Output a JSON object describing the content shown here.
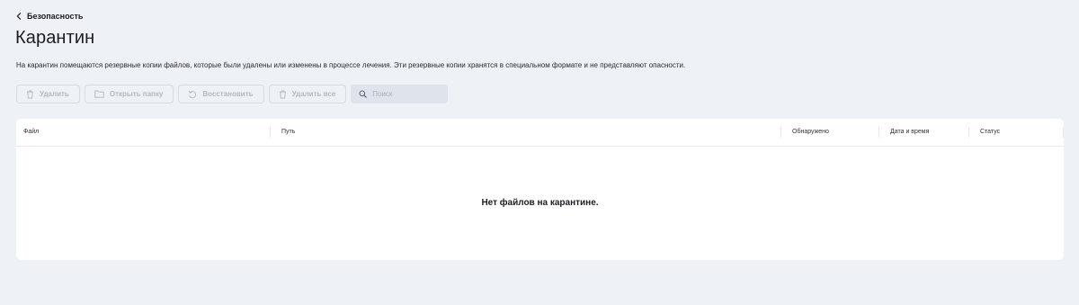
{
  "breadcrumb": {
    "label": "Безопасность"
  },
  "page": {
    "title": "Карантин",
    "description": "На карантин помещаются резервные копии файлов, которые были удалены или изменены в процессе лечения. Эти резервные копии хранятся в специальном формате и не представляют опасности."
  },
  "toolbar": {
    "delete_label": "Удалить",
    "open_folder_label": "Открыть папку",
    "restore_label": "Восстановить",
    "delete_all_label": "Удалить все",
    "search_placeholder": "Поиск",
    "search_value": "",
    "buttons_disabled": true
  },
  "table": {
    "columns": [
      "Файл",
      "Путь",
      "Обнаружено",
      "Дата и время",
      "Статус"
    ],
    "rows": [],
    "empty_message": "Нет файлов на карантине."
  },
  "icons": {
    "back": "chevron-left-icon",
    "delete": "trash-icon",
    "folder": "folder-icon",
    "restore": "restore-icon",
    "search": "search-icon"
  },
  "colors": {
    "background": "#eef1f6",
    "card": "#ffffff",
    "text": "#1c1d22",
    "disabled_text": "#b3b8c3",
    "search_bg": "#dfe4ec"
  }
}
